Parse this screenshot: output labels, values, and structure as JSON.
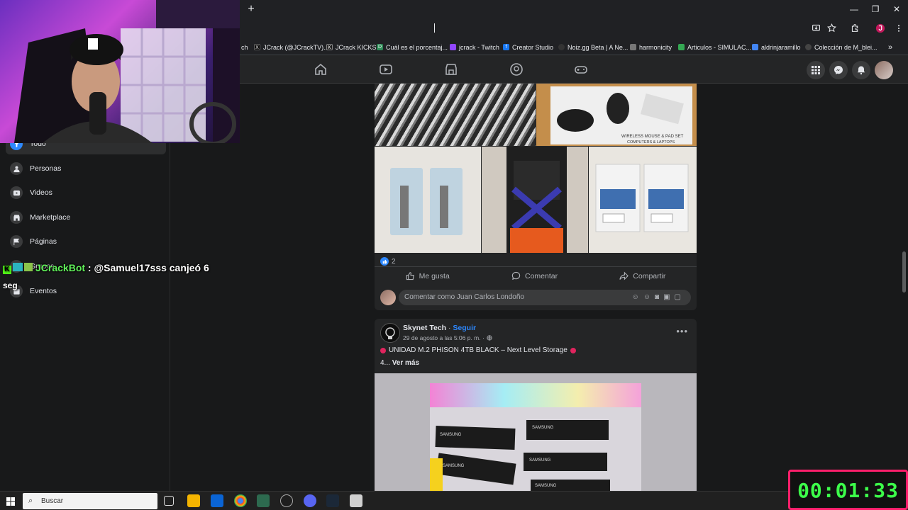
{
  "browser": {
    "new_tab_symbol": "+",
    "window": {
      "minimize": "—",
      "restore": "❐",
      "close": "✕"
    },
    "bookmarks": [
      {
        "label": "ch",
        "color": "#5f6368"
      },
      {
        "label": "JCrack (@JCrackTV)...",
        "color": "#000000"
      },
      {
        "label": "JCrack KICKS",
        "color": "#1f1f1f"
      },
      {
        "label": "Cuál es el porcentaj...",
        "color": "#2e8b57"
      },
      {
        "label": "jcrack - Twitch",
        "color": "#9146ff"
      },
      {
        "label": "Creator Studio",
        "color": "#1877f2"
      },
      {
        "label": "Noiz.gg Beta | A Ne...",
        "color": "#333333"
      },
      {
        "label": "harmonicity",
        "color": "#777777"
      },
      {
        "label": "Articulos - SIMULAC...",
        "color": "#34a853"
      },
      {
        "label": "aldrinjaramillo",
        "color": "#4285f4"
      },
      {
        "label": "Colección de M_blei...",
        "color": "#444444"
      }
    ],
    "overflow": "»"
  },
  "sidebar": {
    "items": [
      {
        "label": "Todo",
        "icon": "filter-icon"
      },
      {
        "label": "Personas",
        "icon": "people-icon"
      },
      {
        "label": "Videos",
        "icon": "video-icon"
      },
      {
        "label": "Marketplace",
        "icon": "shop-icon"
      },
      {
        "label": "Páginas",
        "icon": "flag-icon"
      },
      {
        "label": "Grupos",
        "icon": "groups-icon"
      },
      {
        "label": "Eventos",
        "icon": "calendar-icon"
      }
    ]
  },
  "chat": {
    "user": "JCrackBot",
    "message": " : @Samuel17sss canjeó 6",
    "continuation": "seg"
  },
  "post1": {
    "reaction_count": "2",
    "like_label": "Me gusta",
    "comment_label": "Comentar",
    "share_label": "Compartir",
    "comment_placeholder": "Comentar como Juan Carlos Londoño",
    "photo_caption": "WIRELESS MOUSE & PAD SET",
    "photo_caption2": "COMPUTERS & LAPTOPS"
  },
  "post2": {
    "author": "Skynet Tech",
    "follow": "Seguir",
    "date": "29 de agosto a las 5:06 p. m. ·",
    "text": "UNIDAD M.2 PHISON 4TB BLACK – Next Level Storage",
    "more_prefix": "4...",
    "more_label": "Ver más",
    "ssd_label": "SAMSUNG"
  },
  "taskbar": {
    "search_placeholder": "Buscar"
  },
  "timer": {
    "value": "00:01:33"
  }
}
